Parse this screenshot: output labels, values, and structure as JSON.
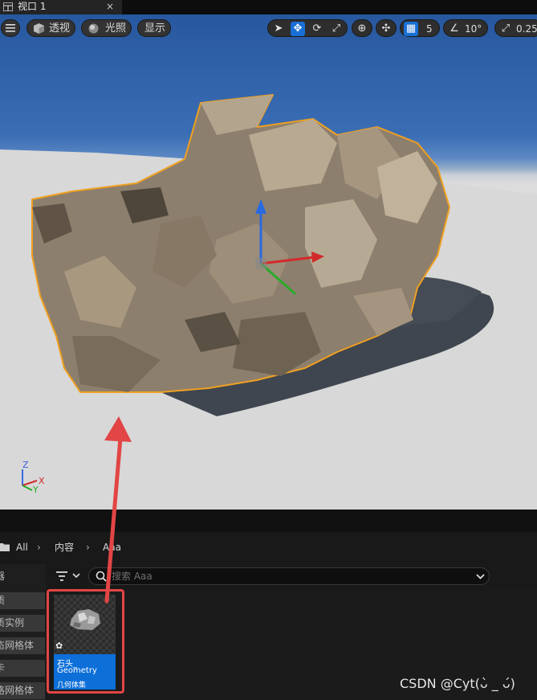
{
  "window": {
    "tab_title": "视口 1",
    "close_glyph": "×"
  },
  "viewport_toolbar": {
    "menu_icon": "hamburger-menu-icon",
    "perspective_label": "透视",
    "lighting_label": "光照",
    "show_label": "显示",
    "transform_tools": [
      "select-arrow-icon",
      "move-icon",
      "rotate-icon",
      "scale-icon"
    ],
    "active_tool": "move-icon",
    "grid_snap_value": "5",
    "rotation_snap_value": "10°",
    "scale_snap_value": "0.25"
  },
  "axis_gizmo": {
    "z": "Z",
    "x": "X",
    "y": "Y"
  },
  "content_browser": {
    "breadcrumbs": [
      "All",
      "内容",
      "Aaa"
    ],
    "sidebar_items": [
      "器",
      "质",
      "质实例",
      "态网格体",
      "卡",
      "格网格体"
    ],
    "search_placeholder": "搜索 Aaa",
    "asset": {
      "name_line1": "石头_",
      "name_line2": "Geometry",
      "type": "几何体集"
    }
  },
  "watermark": "CSDN @Cyt(ᴗ̀ _ ᴗ́)",
  "colors": {
    "active_blue": "#0d6fd8",
    "selection_orange": "#f0a020",
    "annotation_red": "#e24545"
  }
}
